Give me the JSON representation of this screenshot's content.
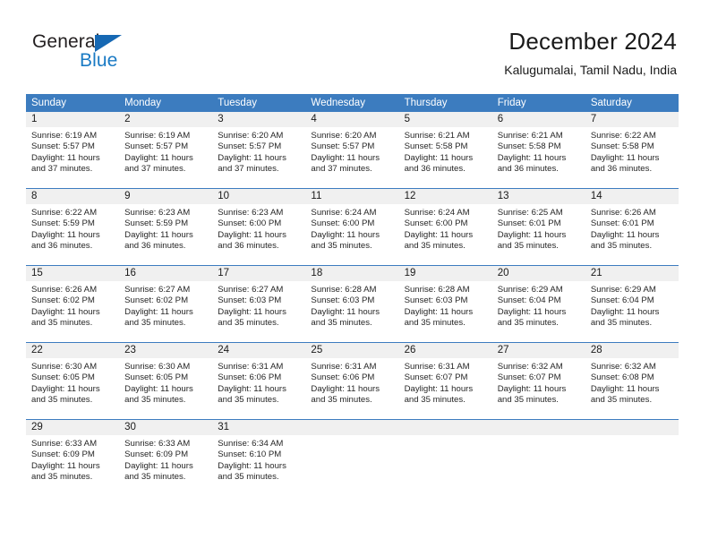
{
  "brand": {
    "name_part1": "General",
    "name_part2": "Blue",
    "accent_color": "#1a7ac4",
    "triangle_color": "#1668b3"
  },
  "header": {
    "title": "December 2024",
    "subtitle": "Kalugumalai, Tamil Nadu, India"
  },
  "calendar": {
    "header_bg": "#3c7cbf",
    "daynum_bg": "#f0f0f0",
    "weekday_headers": [
      "Sunday",
      "Monday",
      "Tuesday",
      "Wednesday",
      "Thursday",
      "Friday",
      "Saturday"
    ],
    "weeks": [
      [
        {
          "day": "1",
          "sunrise": "Sunrise: 6:19 AM",
          "sunset": "Sunset: 5:57 PM",
          "daylight": "Daylight: 11 hours and 37 minutes."
        },
        {
          "day": "2",
          "sunrise": "Sunrise: 6:19 AM",
          "sunset": "Sunset: 5:57 PM",
          "daylight": "Daylight: 11 hours and 37 minutes."
        },
        {
          "day": "3",
          "sunrise": "Sunrise: 6:20 AM",
          "sunset": "Sunset: 5:57 PM",
          "daylight": "Daylight: 11 hours and 37 minutes."
        },
        {
          "day": "4",
          "sunrise": "Sunrise: 6:20 AM",
          "sunset": "Sunset: 5:57 PM",
          "daylight": "Daylight: 11 hours and 37 minutes."
        },
        {
          "day": "5",
          "sunrise": "Sunrise: 6:21 AM",
          "sunset": "Sunset: 5:58 PM",
          "daylight": "Daylight: 11 hours and 36 minutes."
        },
        {
          "day": "6",
          "sunrise": "Sunrise: 6:21 AM",
          "sunset": "Sunset: 5:58 PM",
          "daylight": "Daylight: 11 hours and 36 minutes."
        },
        {
          "day": "7",
          "sunrise": "Sunrise: 6:22 AM",
          "sunset": "Sunset: 5:58 PM",
          "daylight": "Daylight: 11 hours and 36 minutes."
        }
      ],
      [
        {
          "day": "8",
          "sunrise": "Sunrise: 6:22 AM",
          "sunset": "Sunset: 5:59 PM",
          "daylight": "Daylight: 11 hours and 36 minutes."
        },
        {
          "day": "9",
          "sunrise": "Sunrise: 6:23 AM",
          "sunset": "Sunset: 5:59 PM",
          "daylight": "Daylight: 11 hours and 36 minutes."
        },
        {
          "day": "10",
          "sunrise": "Sunrise: 6:23 AM",
          "sunset": "Sunset: 6:00 PM",
          "daylight": "Daylight: 11 hours and 36 minutes."
        },
        {
          "day": "11",
          "sunrise": "Sunrise: 6:24 AM",
          "sunset": "Sunset: 6:00 PM",
          "daylight": "Daylight: 11 hours and 35 minutes."
        },
        {
          "day": "12",
          "sunrise": "Sunrise: 6:24 AM",
          "sunset": "Sunset: 6:00 PM",
          "daylight": "Daylight: 11 hours and 35 minutes."
        },
        {
          "day": "13",
          "sunrise": "Sunrise: 6:25 AM",
          "sunset": "Sunset: 6:01 PM",
          "daylight": "Daylight: 11 hours and 35 minutes."
        },
        {
          "day": "14",
          "sunrise": "Sunrise: 6:26 AM",
          "sunset": "Sunset: 6:01 PM",
          "daylight": "Daylight: 11 hours and 35 minutes."
        }
      ],
      [
        {
          "day": "15",
          "sunrise": "Sunrise: 6:26 AM",
          "sunset": "Sunset: 6:02 PM",
          "daylight": "Daylight: 11 hours and 35 minutes."
        },
        {
          "day": "16",
          "sunrise": "Sunrise: 6:27 AM",
          "sunset": "Sunset: 6:02 PM",
          "daylight": "Daylight: 11 hours and 35 minutes."
        },
        {
          "day": "17",
          "sunrise": "Sunrise: 6:27 AM",
          "sunset": "Sunset: 6:03 PM",
          "daylight": "Daylight: 11 hours and 35 minutes."
        },
        {
          "day": "18",
          "sunrise": "Sunrise: 6:28 AM",
          "sunset": "Sunset: 6:03 PM",
          "daylight": "Daylight: 11 hours and 35 minutes."
        },
        {
          "day": "19",
          "sunrise": "Sunrise: 6:28 AM",
          "sunset": "Sunset: 6:03 PM",
          "daylight": "Daylight: 11 hours and 35 minutes."
        },
        {
          "day": "20",
          "sunrise": "Sunrise: 6:29 AM",
          "sunset": "Sunset: 6:04 PM",
          "daylight": "Daylight: 11 hours and 35 minutes."
        },
        {
          "day": "21",
          "sunrise": "Sunrise: 6:29 AM",
          "sunset": "Sunset: 6:04 PM",
          "daylight": "Daylight: 11 hours and 35 minutes."
        }
      ],
      [
        {
          "day": "22",
          "sunrise": "Sunrise: 6:30 AM",
          "sunset": "Sunset: 6:05 PM",
          "daylight": "Daylight: 11 hours and 35 minutes."
        },
        {
          "day": "23",
          "sunrise": "Sunrise: 6:30 AM",
          "sunset": "Sunset: 6:05 PM",
          "daylight": "Daylight: 11 hours and 35 minutes."
        },
        {
          "day": "24",
          "sunrise": "Sunrise: 6:31 AM",
          "sunset": "Sunset: 6:06 PM",
          "daylight": "Daylight: 11 hours and 35 minutes."
        },
        {
          "day": "25",
          "sunrise": "Sunrise: 6:31 AM",
          "sunset": "Sunset: 6:06 PM",
          "daylight": "Daylight: 11 hours and 35 minutes."
        },
        {
          "day": "26",
          "sunrise": "Sunrise: 6:31 AM",
          "sunset": "Sunset: 6:07 PM",
          "daylight": "Daylight: 11 hours and 35 minutes."
        },
        {
          "day": "27",
          "sunrise": "Sunrise: 6:32 AM",
          "sunset": "Sunset: 6:07 PM",
          "daylight": "Daylight: 11 hours and 35 minutes."
        },
        {
          "day": "28",
          "sunrise": "Sunrise: 6:32 AM",
          "sunset": "Sunset: 6:08 PM",
          "daylight": "Daylight: 11 hours and 35 minutes."
        }
      ],
      [
        {
          "day": "29",
          "sunrise": "Sunrise: 6:33 AM",
          "sunset": "Sunset: 6:09 PM",
          "daylight": "Daylight: 11 hours and 35 minutes."
        },
        {
          "day": "30",
          "sunrise": "Sunrise: 6:33 AM",
          "sunset": "Sunset: 6:09 PM",
          "daylight": "Daylight: 11 hours and 35 minutes."
        },
        {
          "day": "31",
          "sunrise": "Sunrise: 6:34 AM",
          "sunset": "Sunset: 6:10 PM",
          "daylight": "Daylight: 11 hours and 35 minutes."
        },
        {
          "day": "",
          "sunrise": "",
          "sunset": "",
          "daylight": ""
        },
        {
          "day": "",
          "sunrise": "",
          "sunset": "",
          "daylight": ""
        },
        {
          "day": "",
          "sunrise": "",
          "sunset": "",
          "daylight": ""
        },
        {
          "day": "",
          "sunrise": "",
          "sunset": "",
          "daylight": ""
        }
      ]
    ]
  }
}
